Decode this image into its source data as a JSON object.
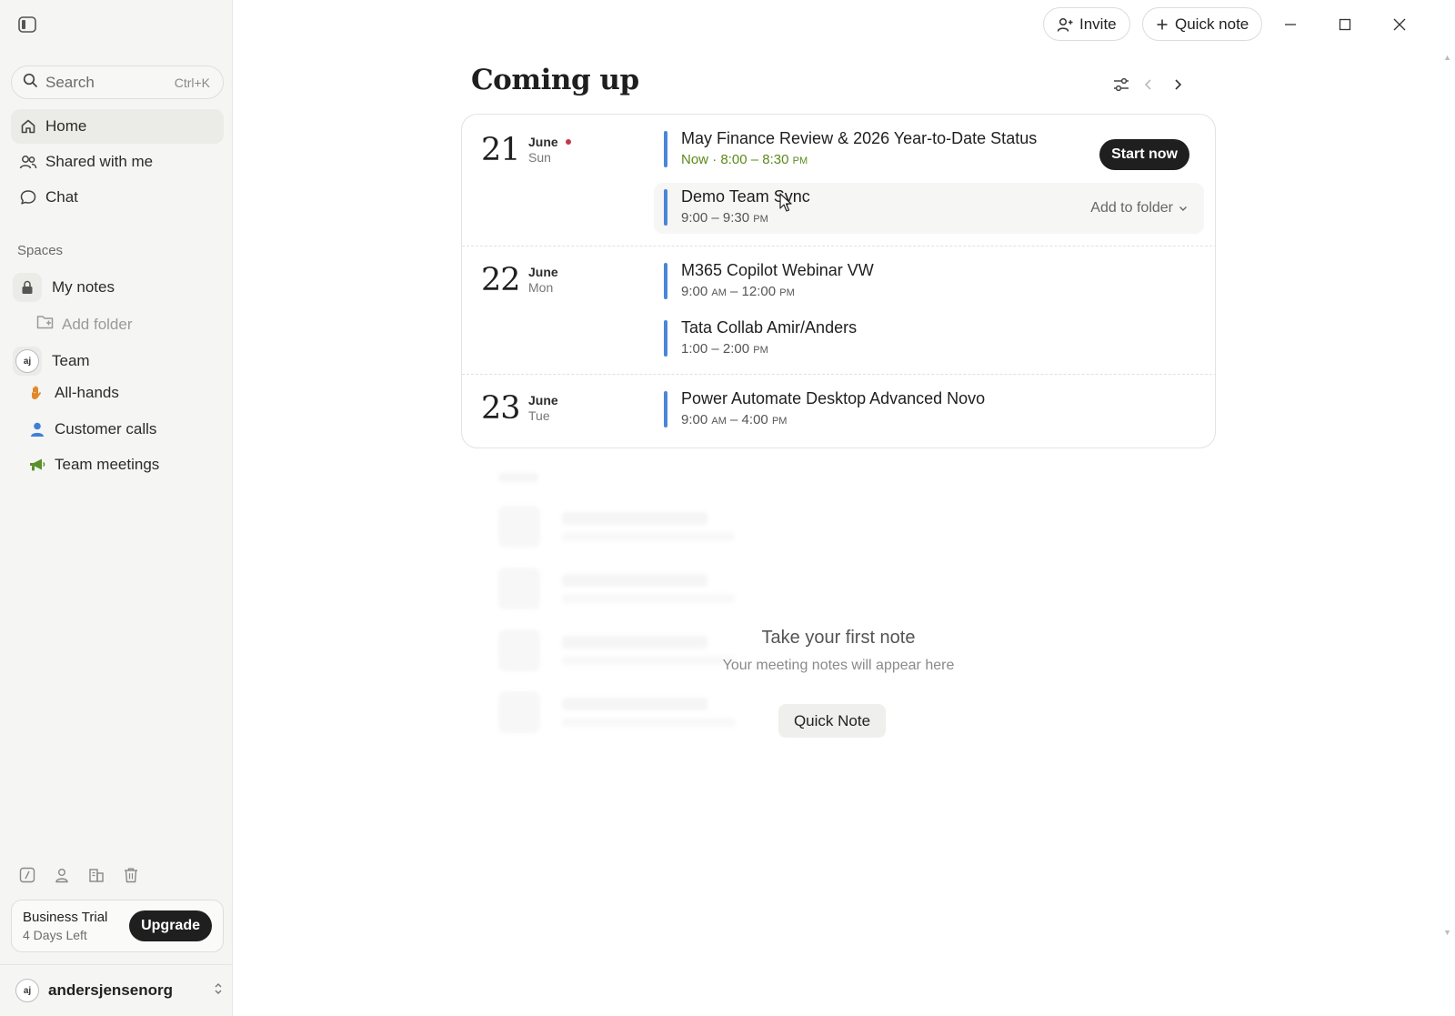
{
  "sidebar": {
    "search": {
      "placeholder": "Search",
      "shortcut": "Ctrl+K"
    },
    "nav": [
      {
        "label": "Home",
        "icon": "home-icon",
        "active": true
      },
      {
        "label": "Shared with me",
        "icon": "people-icon",
        "active": false
      },
      {
        "label": "Chat",
        "icon": "chat-icon",
        "active": false
      }
    ],
    "spaces_label": "Spaces",
    "my_notes": {
      "label": "My notes",
      "icon": "lock-icon"
    },
    "add_folder": "Add folder",
    "team": {
      "label": "Team",
      "avatar": "aj"
    },
    "folders": [
      {
        "label": "All-hands",
        "icon": "hand-icon",
        "color": "#e0892a"
      },
      {
        "label": "Customer calls",
        "icon": "person-icon",
        "color": "#3f7fd6"
      },
      {
        "label": "Team meetings",
        "icon": "megaphone-icon",
        "color": "#5a8f2a"
      }
    ],
    "trial": {
      "title": "Business Trial",
      "days_left": "4 Days Left",
      "upgrade": "Upgrade"
    },
    "user": {
      "avatar": "aj",
      "name": "andersjensenorg"
    }
  },
  "toolbar": {
    "invite": "Invite",
    "quick_note": "Quick note"
  },
  "main": {
    "title": "Coming up",
    "days": [
      {
        "day": "21",
        "month": "June",
        "dow": "Sun",
        "today": true,
        "events": [
          {
            "title": "May Finance Review & 2026 Year-to-Date Status",
            "now_label": "Now",
            "separator": "·",
            "time": "8:00 – 8:30",
            "ampm": "PM",
            "action": "Start now"
          },
          {
            "title": "Demo Team Sync",
            "time": "9:00 – 9:30",
            "ampm": "PM",
            "action": "Add to folder"
          }
        ]
      },
      {
        "day": "22",
        "month": "June",
        "dow": "Mon",
        "events": [
          {
            "title": "M365 Copilot Webinar VW",
            "time_start": "9:00",
            "start_ampm": "AM",
            "time_end": "– 12:00",
            "end_ampm": "PM"
          },
          {
            "title": "Tata Collab Amir/Anders",
            "time": "1:00 – 2:00",
            "ampm": "PM"
          }
        ]
      },
      {
        "day": "23",
        "month": "June",
        "dow": "Tue",
        "events": [
          {
            "title": "Power Automate Desktop Advanced Novo",
            "time_start": "9:00",
            "start_ampm": "AM",
            "time_end": "– 4:00",
            "end_ampm": "PM"
          }
        ]
      }
    ],
    "empty": {
      "title": "Take your first note",
      "subtitle": "Your meeting notes will appear here",
      "button": "Quick Note"
    }
  },
  "colors": {
    "accent_bar": "#4a86d9",
    "now_text": "#5c8a1a",
    "today_dot": "#c0394b",
    "dark_button": "#1f1f1f"
  }
}
